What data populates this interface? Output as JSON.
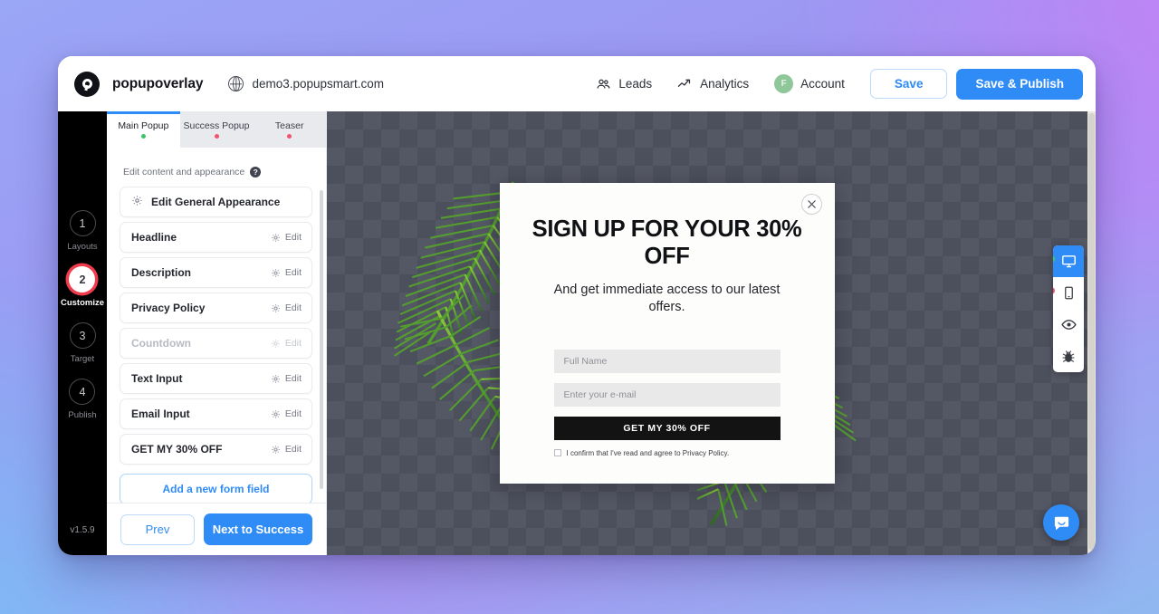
{
  "header": {
    "brand_name": "popupoverlay",
    "globe_icon": "globe-icon",
    "site_url": "demo3.popupsmart.com",
    "leads_label": "Leads",
    "analytics_label": "Analytics",
    "account_label": "Account",
    "account_initial": "F",
    "save_label": "Save",
    "save_publish_label": "Save & Publish"
  },
  "rail": {
    "steps": [
      {
        "number": "1",
        "label": "Layouts"
      },
      {
        "number": "2",
        "label": "Customize"
      },
      {
        "number": "3",
        "label": "Target"
      },
      {
        "number": "4",
        "label": "Publish"
      }
    ],
    "version": "v1.5.9"
  },
  "panel": {
    "tabs": [
      {
        "label": "Main Popup",
        "status": "green"
      },
      {
        "label": "Success Popup",
        "status": "red"
      },
      {
        "label": "Teaser",
        "status": "red"
      }
    ],
    "subtitle": "Edit content and appearance",
    "help_icon": "help-icon",
    "general_appearance_label": "Edit General Appearance",
    "edit_label": "Edit",
    "items": [
      {
        "label": "Headline",
        "disabled": false
      },
      {
        "label": "Description",
        "disabled": false
      },
      {
        "label": "Privacy Policy",
        "disabled": false
      },
      {
        "label": "Countdown",
        "disabled": true
      },
      {
        "label": "Text Input",
        "disabled": false
      },
      {
        "label": "Email Input",
        "disabled": false
      },
      {
        "label": "GET MY 30% OFF",
        "disabled": false
      }
    ],
    "add_field_label": "Add a new form field",
    "prev_label": "Prev",
    "next_label": "Next to Success"
  },
  "popup": {
    "close_icon": "close-icon",
    "headline": "SIGN UP FOR YOUR 30% OFF",
    "description": "And get immediate access to our latest offers.",
    "name_placeholder": "Full Name",
    "email_placeholder": "Enter your e-mail",
    "cta_label": "GET MY 30% OFF",
    "consent_text": "I confirm that I've read and agree to Privacy Policy."
  },
  "device_toolbar": {
    "buttons": [
      {
        "icon": "desktop-icon",
        "active": true,
        "badge": "green"
      },
      {
        "icon": "mobile-icon",
        "active": false,
        "badge": "red"
      },
      {
        "icon": "eye-icon",
        "active": false,
        "badge": ""
      },
      {
        "icon": "bug-icon",
        "active": false,
        "badge": ""
      }
    ]
  },
  "chat": {
    "icon": "chat-bubble-icon"
  },
  "colors": {
    "accent_blue": "#2f8cf6",
    "active_step_red": "#ef3b4b",
    "status_green": "#3ec46d",
    "status_red": "#f2546b",
    "popup_cta_bg": "#131313"
  }
}
